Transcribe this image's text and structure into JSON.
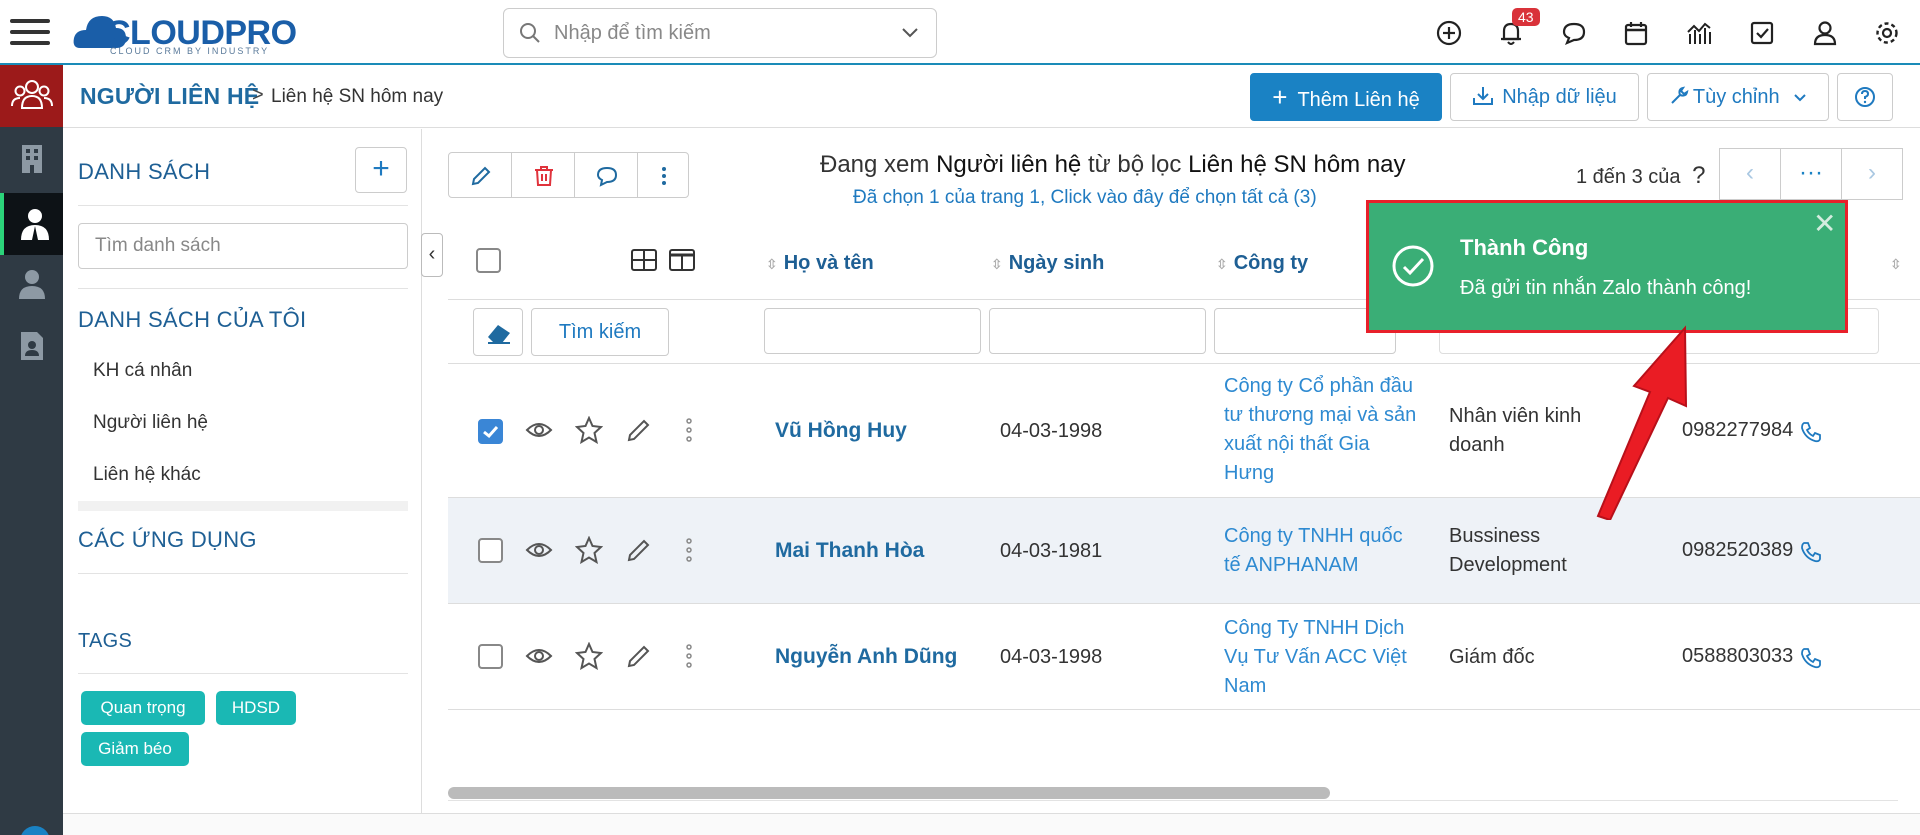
{
  "app": {
    "logo": "CLOUDPRO",
    "logo_sub": "CLOUD CRM BY INDUSTRY"
  },
  "topbar": {
    "search_placeholder": "Nhập để tìm kiếm",
    "notif_count": "43"
  },
  "breadcrumb": {
    "main": "NGƯỜI LIÊN HỆ",
    "separator": ">",
    "sub": "Liên hệ SN hôm nay"
  },
  "header_buttons": {
    "add": "Thêm Liên hệ",
    "import": "Nhập dữ liệu",
    "custom": "Tùy chỉnh"
  },
  "left_panel": {
    "list_title": "DANH SÁCH",
    "list_search_placeholder": "Tìm danh sách",
    "my_lists_title": "DANH SÁCH CỦA TÔI",
    "my_lists": [
      "KH cá nhân",
      "Người liên hệ",
      "Liên hệ khác"
    ],
    "apps_title": "CÁC ỨNG DỤNG",
    "tags_title": "TAGS",
    "tags": [
      "Quan trọng",
      "HDSD",
      "Giảm béo"
    ]
  },
  "view_info": {
    "prefix": "Đang xem ",
    "module": "Người liên hệ",
    "middle": " từ bộ lọc ",
    "filter": "Liên hệ SN hôm nay",
    "selection": "Đã chọn 1 của trang 1, Click vào đây để chọn tất cả (3)"
  },
  "pager": {
    "text": "1 đến 3 của",
    "unknown": "?"
  },
  "table": {
    "search_label": "Tìm kiếm",
    "columns": [
      "Họ và tên",
      "Ngày sinh",
      "Công ty"
    ],
    "rows": [
      {
        "name": "Vũ Hồng Huy",
        "dob": "04-03-1998",
        "company": "Công ty Cổ phần đầu tư thương mại và sản xuất nội thất Gia Hưng",
        "title": "Nhân viên kinh doanh",
        "phone": "0982277984",
        "selected": true
      },
      {
        "name": "Mai Thanh Hòa",
        "dob": "04-03-1981",
        "company": "Công ty TNHH quốc tế ANPHANAM",
        "title": "Bussiness Development",
        "phone": "0982520389",
        "selected": false
      },
      {
        "name": "Nguyễn Anh Dũng",
        "dob": "04-03-1998",
        "company": "Công Ty TNHH Dịch Vụ Tư Vấn ACC Việt Nam",
        "title": "Giám đốc",
        "phone": "0588803033",
        "selected": false
      }
    ]
  },
  "toast": {
    "title": "Thành Công",
    "message": "Đã gửi tin nhắn Zalo thành công!"
  },
  "colors": {
    "accent": "#1a82c4",
    "success": "#3aae76",
    "highlight": "#e8202a",
    "sidebar": "#2f3a44"
  }
}
